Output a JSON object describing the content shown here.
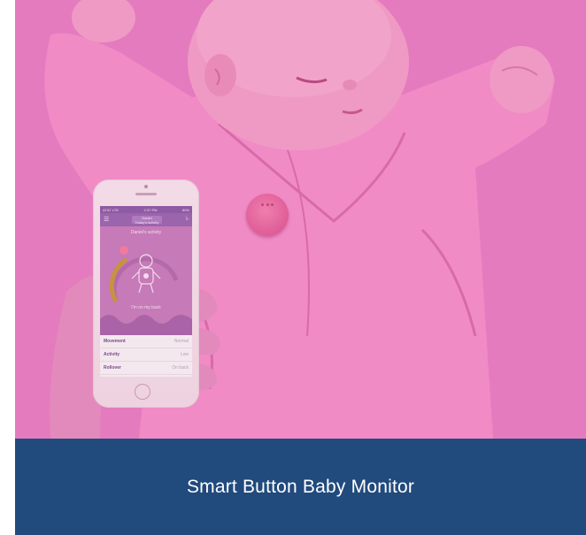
{
  "caption": {
    "title": "Smart Button Baby Monitor"
  },
  "hero": {
    "overlay_color": "#e97ac0",
    "phone_app": {
      "status_carrier": "AT&T LTE",
      "status_time": "2:37 PM",
      "status_battery": "80%",
      "nav_title": "Daniel",
      "nav_subtitle": "Today's activity",
      "activity_heading": "Daniel's activity",
      "position_label": "I'm on my back",
      "rows": [
        {
          "label": "Movement",
          "value": "Normal"
        },
        {
          "label": "Activity",
          "value": "Low"
        },
        {
          "label": "Rollover",
          "value": "On back"
        }
      ]
    }
  },
  "colors": {
    "caption_bg": "#214a7d",
    "caption_text": "#ffffff"
  }
}
